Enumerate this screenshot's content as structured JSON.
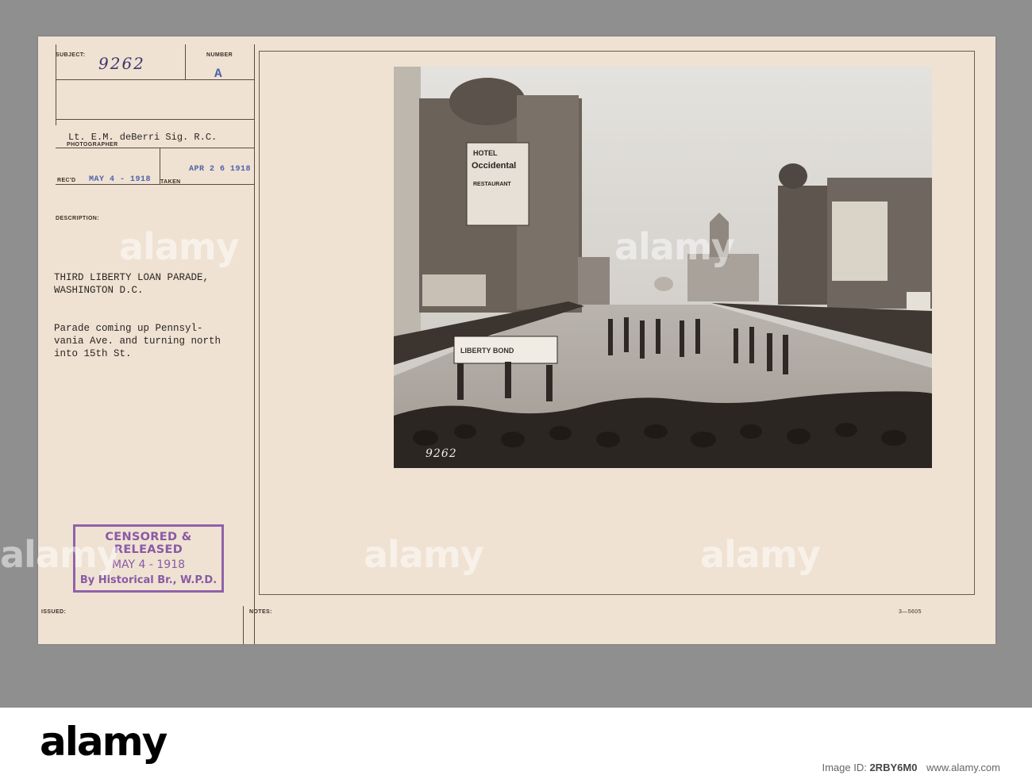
{
  "card": {
    "subject_label": "SUBJECT:",
    "subject_value": "9262",
    "number_label": "NUMBER",
    "number_value": "A",
    "photographer_name": "Lt. E.M. deBerri Sig. R.C.",
    "photographer_label": "PHOTOGRAPHER",
    "recd_label": "REC'D",
    "recd_date": "MAY 4 - 1918",
    "taken_label": "TAKEN",
    "taken_date": "APR 2 6 1918",
    "description_label": "DESCRIPTION:",
    "description_title": "THIRD LIBERTY LOAN PARADE,\nWASHINGTON D.C.",
    "description_body": "Parade coming up Pennsyl-\nvania Ave. and turning north\ninto 15th St.",
    "issued_label": "ISSUED:",
    "notes_label": "NOTES:",
    "form_code": "3—5605"
  },
  "stamp": {
    "line1": "CENSORED & RELEASED",
    "line2": "MAY 4 - 1918",
    "line3": "By Historical Br., W.P.D.",
    "color": "#8f62a8"
  },
  "photo": {
    "negative_number": "9262",
    "sign_hotel": "HOTEL",
    "sign_hotel_name": "Occidental",
    "sign_restaurant": "RESTAURANT",
    "banner_text": "LIBERTY BOND"
  },
  "watermark": "alamy",
  "footer": {
    "logo": "alamy",
    "image_id_label": "Image ID:",
    "image_id": "2RBY6M0",
    "site": "www.alamy.com"
  }
}
